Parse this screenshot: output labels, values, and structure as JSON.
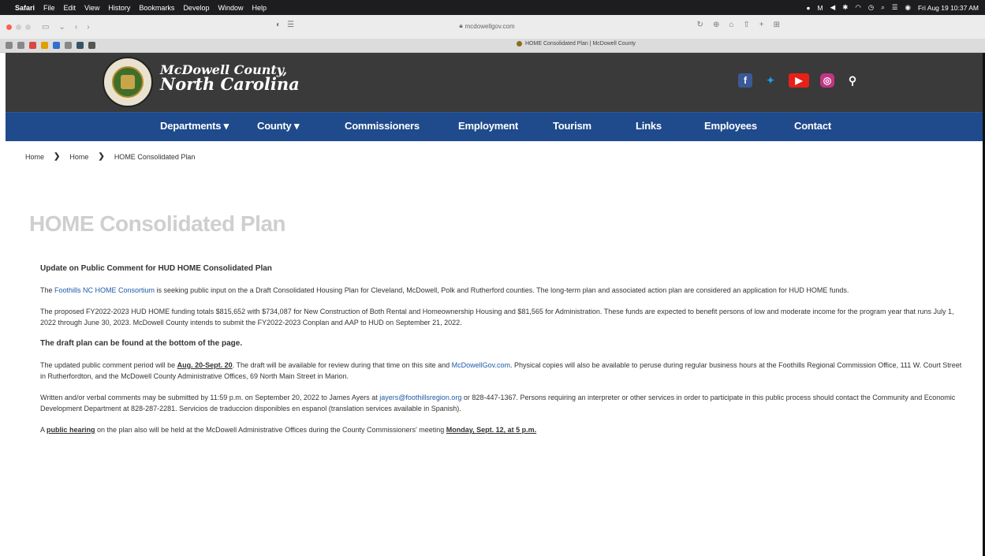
{
  "menubar": {
    "app": "Safari",
    "items": [
      "File",
      "Edit",
      "View",
      "History",
      "Bookmarks",
      "Develop",
      "Window",
      "Help"
    ],
    "clock": "Fri Aug 19 10:37 AM"
  },
  "browser": {
    "url": "mcdowellgov.com",
    "tab_title": "HOME Consolidated Plan | McDowell County"
  },
  "site": {
    "brand_line1": "McDowell County,",
    "brand_line2": "North Carolina",
    "social": [
      "facebook-icon",
      "twitter-icon",
      "youtube-icon",
      "instagram-icon",
      "search-icon"
    ],
    "nav": [
      "Departments ▾",
      "County ▾",
      "Commissioners",
      "Employment",
      "Tourism",
      "Links",
      "Employees",
      "Contact"
    ]
  },
  "breadcrumb": [
    "Home",
    "Home",
    "HOME Consolidated Plan"
  ],
  "page": {
    "title": "HOME Consolidated Plan",
    "update_heading": "Update on Public Comment for HUD HOME Consolidated Plan",
    "p1_prefix": "The ",
    "p1_link": "Foothills NC HOME Consortium",
    "p1_suffix": " is seeking public input on the a Draft Consolidated Housing Plan for Cleveland, McDowell, Polk and Rutherford counties. The long-term plan and associated action plan are considered an application for HUD HOME funds.",
    "p2": "The proposed FY2022-2023 HUD HOME funding totals $815,652 with $734,087 for New Construction of Both Rental and Homeownership Housing and $81,565 for Administration. These funds are expected to benefit persons of low and moderate income for the program year that runs July 1, 2022 through June 30, 2023. McDowell County intends to submit the FY2022-2023 Conplan and AAP to HUD on September 21, 2022.",
    "draft_note": "The draft plan can be found at the bottom of the page.",
    "p3_prefix": "The updated public comment period will be ",
    "p3_dates": "Aug. 20-Sept. 20",
    "p3_mid": ". The draft will be available for review during that time on this site and ",
    "p3_link": "McDowellGov.com",
    "p3_suffix": ". Physical copies will also be available to peruse during regular business hours at the Foothills Regional Commission Office, 111 W. Court Street in Rutherfordton, and the McDowell County Administrative Offices, 69 North Main Street in Marion.",
    "p4_prefix": "Written and/or verbal comments may be submitted by 11:59 p.m. on September 20, 2022 to James Ayers at ",
    "p4_email": "jayers@foothillsregion.org",
    "p4_suffix": " or 828-447-1367. Persons requiring an interpreter or other services in order to participate in this public process should contact the Community and Economic Development Department at 828-287-2281. Servicios de traduccion disponibles en espanol (translation services available in Spanish).",
    "p5_prefix": "A ",
    "p5_link": "public hearing",
    "p5_mid": " on the plan also will be held at the McDowell Administrative Offices during the County Commissioners' meeting ",
    "p5_date": "Monday, Sept. 12, at 5 p.m."
  }
}
